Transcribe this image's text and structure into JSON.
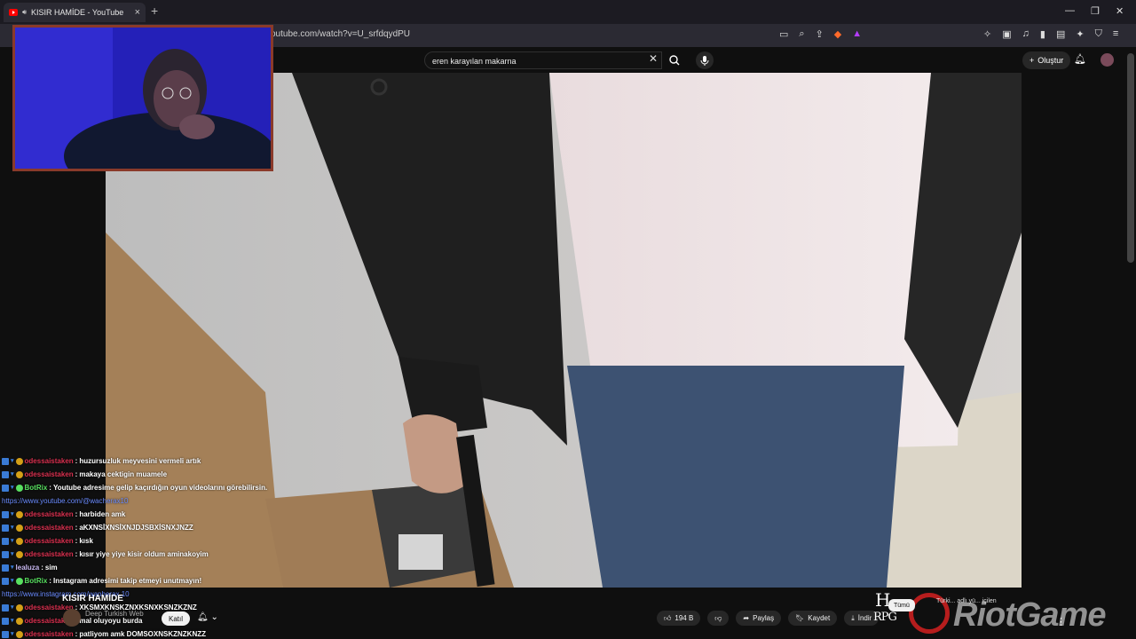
{
  "browser": {
    "tab_title": "KISIR HAMİDE - YouTube",
    "new_tab": "+",
    "url": "youtube.com/watch?v=U_srfdqydPU",
    "window_controls": [
      "—",
      "❐",
      "✕"
    ]
  },
  "youtube": {
    "search_value": "eren karayılan makarna",
    "create_label": "Oluştur",
    "channel_name": "KISIR HAMİDE",
    "channel_sub": "Deep Turkish Web",
    "join_label": "Katıl",
    "like_count": "194 B",
    "share_label": "Paylaş",
    "save_label": "Kaydet",
    "download_label": "İndir",
    "chip_all": "Tümü",
    "related_text": "Türki... adlı yü... içilen"
  },
  "chat": [
    {
      "user": "odessaistaken",
      "text": "huzursuzluk meyvesini vermeli artık",
      "kind": "user"
    },
    {
      "user": "odessaistaken",
      "text": "makaya cektigin muamele",
      "kind": "user"
    },
    {
      "user": "BotRix",
      "text": "Youtube adresime gelip kaçırdığın oyun videolarını görebilirsin.",
      "kind": "bot"
    },
    {
      "link": "https://www.youtube.com/@wacherax10"
    },
    {
      "user": "odessaistaken",
      "text": "harbiden amk",
      "kind": "user"
    },
    {
      "user": "odessaistaken",
      "text": "aKXNSİXNSİXNJDJSBXİSNXJNZZ",
      "kind": "user"
    },
    {
      "user": "odessaistaken",
      "text": "kısk",
      "kind": "user"
    },
    {
      "user": "odessaistaken",
      "text": "kısır yiye yiye kisir oldum aminakoyim",
      "kind": "user"
    },
    {
      "user": "lealuza",
      "text": "sim",
      "kind": "lea"
    },
    {
      "user": "BotRix",
      "text": "Instagram adresimi takip etmeyi unutmayın!",
      "kind": "bot"
    },
    {
      "link": "https://www.instagram.com/wapherax.10"
    },
    {
      "user": "odessaistaken",
      "text": "XKSMXKNSKZNXKSNXKSNZKZNZ",
      "kind": "user"
    },
    {
      "user": "odessaistaken",
      "text": "mal oluyoyu burda",
      "kind": "user"
    },
    {
      "user": "odessaistaken",
      "text": "patliyom amk DOMSOXNSKZNZKNZZ",
      "kind": "user"
    }
  ],
  "watermark": {
    "h": "H",
    "rpg": "RPG",
    "game": "RiotGame"
  }
}
